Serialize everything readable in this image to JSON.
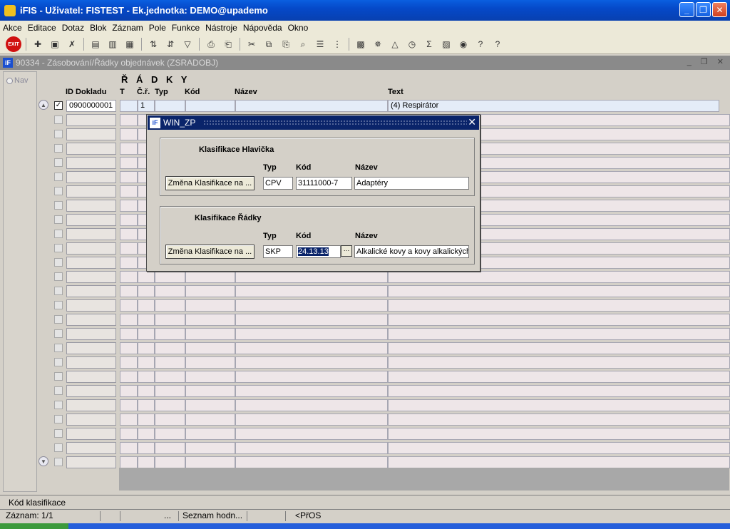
{
  "window": {
    "title": "iFIS - Uživatel: FISTEST - Ek.jednotka: DEMO@upademo"
  },
  "menu": [
    "Akce",
    "Editace",
    "Dotaz",
    "Blok",
    "Záznam",
    "Pole",
    "Funkce",
    "Nástroje",
    "Nápověda",
    "Okno"
  ],
  "toolbar": {
    "exit_label": "EXIT"
  },
  "form": {
    "title": "90334 - Zásobování/Řádky objednávek (ZSRADOBJ)",
    "nav_label": "Nav",
    "block_title": "Ř Á D K Y",
    "headers": {
      "id": "ID Dokladu",
      "t": "T",
      "cr": "Č.ř.",
      "typ": "Typ",
      "kod": "Kód",
      "nazev": "Název",
      "text": "Text"
    },
    "first_row": {
      "id": "0900000001",
      "cr": "1",
      "text": "(4) Respirátor"
    }
  },
  "dialog": {
    "title": "WIN_ZP",
    "header_group": {
      "title": "Klasifikace Hlavička",
      "button": "Změna Klasifikace na ...",
      "typ_label": "Typ",
      "kod_label": "Kód",
      "nazev_label": "Název",
      "typ": "CPV",
      "kod": "31111000-7",
      "nazev": "Adaptéry"
    },
    "rows_group": {
      "title": "Klasifikace Řádky",
      "button": "Změna Klasifikace na ...",
      "typ_label": "Typ",
      "kod_label": "Kód",
      "nazev_label": "Název",
      "typ": "SKP",
      "kod": "24.13.13",
      "nazev": "Alkalické kovy a kovy alkalických"
    }
  },
  "status": {
    "hint": "Kód klasifikace",
    "record": "Záznam: 1/1",
    "dots": "...",
    "list": "Seznam hodn...",
    "mode": "<PřOS"
  }
}
